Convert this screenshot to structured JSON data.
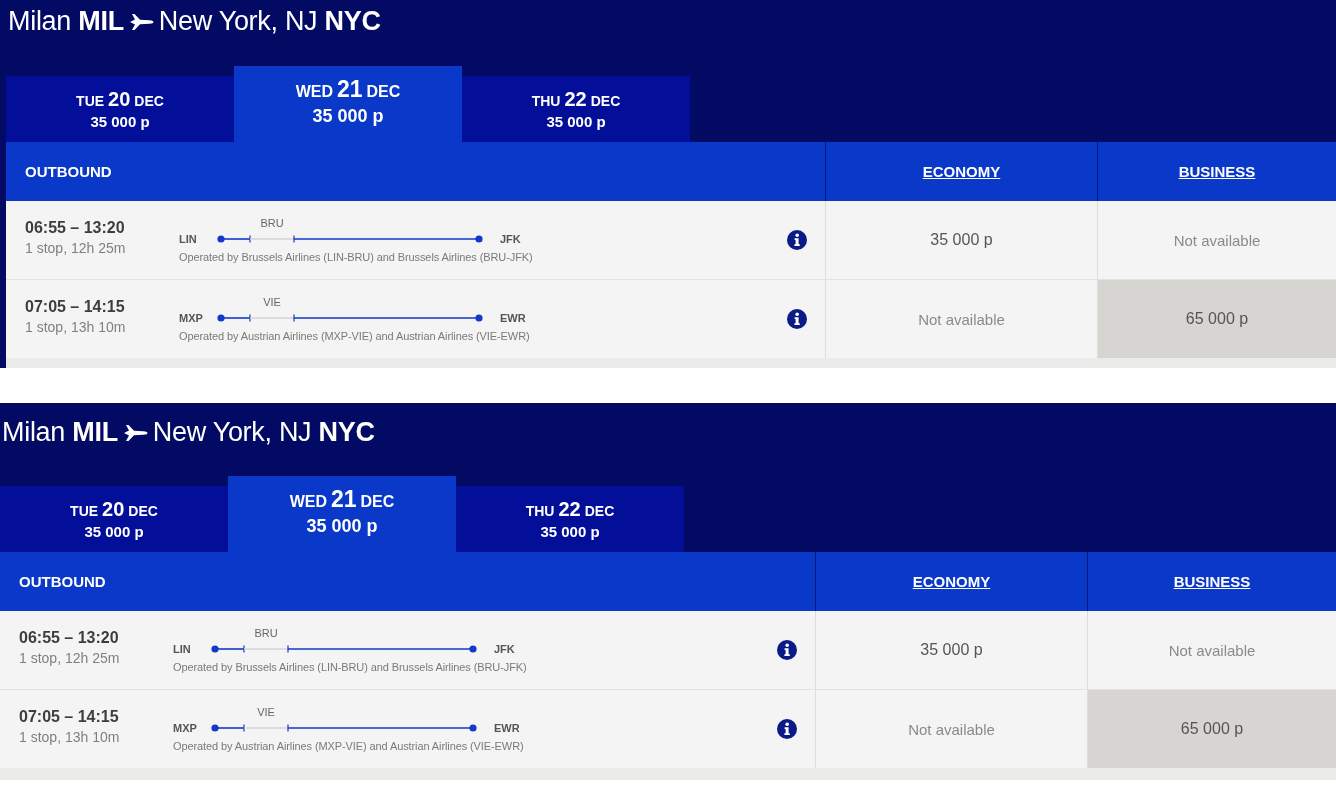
{
  "panels": [
    {
      "route": {
        "origin": "Milan **MIL**",
        "destination": "New York, NJ **NYC**"
      },
      "date_tabs": [
        {
          "weekday": "TUE",
          "day": "20",
          "month": "DEC",
          "price": "35 000 p",
          "selected": false
        },
        {
          "weekday": "WED",
          "day": "21",
          "month": "DEC",
          "price": "35 000 p",
          "selected": true
        },
        {
          "weekday": "THU",
          "day": "22",
          "month": "DEC",
          "price": "35 000 p",
          "selected": false
        }
      ],
      "table": {
        "heading": "OUTBOUND",
        "columns": [
          "ECONOMY",
          "BUSINESS"
        ],
        "flights": [
          {
            "times": "06:55 – 13:20",
            "summary": "1 stop, 12h 25m",
            "from": "LIN",
            "via": "BRU",
            "to": "JFK",
            "operated_by": "Operated by Brussels Airlines (LIN-BRU) and Brussels Airlines (BRU-JFK)",
            "fares": [
              {
                "kind": "price",
                "text": "35 000 p",
                "selected": false
              },
              {
                "kind": "unavailable",
                "text": "Not available",
                "selected": false
              }
            ]
          },
          {
            "times": "07:05 – 14:15",
            "summary": "1 stop, 13h 10m",
            "from": "MXP",
            "via": "VIE",
            "to": "EWR",
            "operated_by": "Operated by Austrian Airlines (MXP-VIE) and Austrian Airlines (VIE-EWR)",
            "fares": [
              {
                "kind": "unavailable",
                "text": "Not available",
                "selected": false
              },
              {
                "kind": "price",
                "text": "65 000 p",
                "selected": true
              }
            ]
          }
        ]
      }
    },
    {
      "route": {
        "origin": "Milan **MIL**",
        "destination": "New York, NJ **NYC**"
      },
      "date_tabs": [
        {
          "weekday": "TUE",
          "day": "20",
          "month": "DEC",
          "price": "35 000 p",
          "selected": false
        },
        {
          "weekday": "WED",
          "day": "21",
          "month": "DEC",
          "price": "35 000 p",
          "selected": true
        },
        {
          "weekday": "THU",
          "day": "22",
          "month": "DEC",
          "price": "35 000 p",
          "selected": false
        }
      ],
      "table": {
        "heading": "OUTBOUND",
        "columns": [
          "ECONOMY",
          "BUSINESS"
        ],
        "flights": [
          {
            "times": "06:55 – 13:20",
            "summary": "1 stop, 12h 25m",
            "from": "LIN",
            "via": "BRU",
            "to": "JFK",
            "operated_by": "Operated by Brussels Airlines (LIN-BRU) and Brussels Airlines (BRU-JFK)",
            "fares": [
              {
                "kind": "price",
                "text": "35 000 p",
                "selected": false
              },
              {
                "kind": "unavailable",
                "text": "Not available",
                "selected": false
              }
            ]
          },
          {
            "times": "07:05 – 14:15",
            "summary": "1 stop, 13h 10m",
            "from": "MXP",
            "via": "VIE",
            "to": "EWR",
            "operated_by": "Operated by Austrian Airlines (MXP-VIE) and Austrian Airlines (VIE-EWR)",
            "fares": [
              {
                "kind": "unavailable",
                "text": "Not available",
                "selected": false
              },
              {
                "kind": "price",
                "text": "65 000 p",
                "selected": true
              }
            ]
          }
        ]
      }
    }
  ]
}
